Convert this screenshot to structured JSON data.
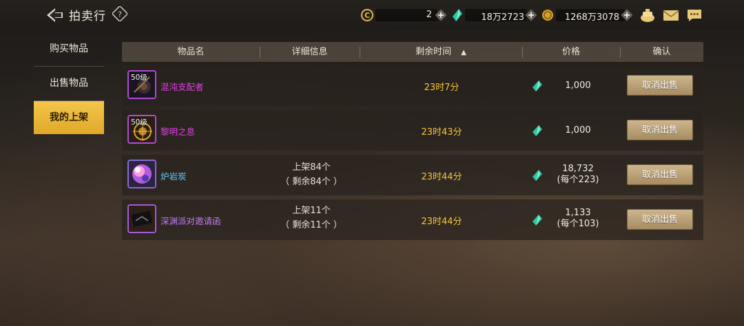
{
  "header": {
    "title": "拍卖行"
  },
  "resources": [
    {
      "icon": "c-coin-icon",
      "value": "2"
    },
    {
      "icon": "green-gem-icon",
      "value": "18万2723"
    },
    {
      "icon": "gold-coin-icon",
      "value": "1268万3078"
    }
  ],
  "sidebar": {
    "items": [
      {
        "label": "购买物品",
        "active": false
      },
      {
        "label": "出售物品",
        "active": false
      },
      {
        "label": "我的上架",
        "active": true
      }
    ]
  },
  "table": {
    "columns": [
      "物品名",
      "详细信息",
      "剩余时间",
      "价格",
      "确认"
    ],
    "sort_indicator": "▲",
    "rows": [
      {
        "name": "混沌支配者",
        "level": "50级",
        "name_color": "#e040e6",
        "detail_line1": "",
        "detail_line2": "",
        "time": "23时7分",
        "price": "1,000",
        "price_each": "",
        "action": "取消出售"
      },
      {
        "name": "黎明之息",
        "level": "50级",
        "name_color": "#e040e6",
        "detail_line1": "",
        "detail_line2": "",
        "time": "23时43分",
        "price": "1,000",
        "price_each": "",
        "action": "取消出售"
      },
      {
        "name": "炉岩炭",
        "level": "",
        "name_color": "#5fc6ff",
        "detail_line1": "上架84个",
        "detail_line2": "（ 剩余84个 ）",
        "time": "23时44分",
        "price": "18,732",
        "price_each": "(每个223)",
        "action": "取消出售"
      },
      {
        "name": "深渊派对邀请函",
        "level": "",
        "name_color": "#c07df0",
        "detail_line1": "上架11个",
        "detail_line2": "（ 剩余11个 ）",
        "time": "23时44分",
        "price": "1,133",
        "price_each": "(每个103)",
        "action": "取消出售"
      }
    ]
  },
  "colors": {
    "accent": "#f4c64a",
    "time": "#f4c63b",
    "button": "#b89a6c"
  }
}
